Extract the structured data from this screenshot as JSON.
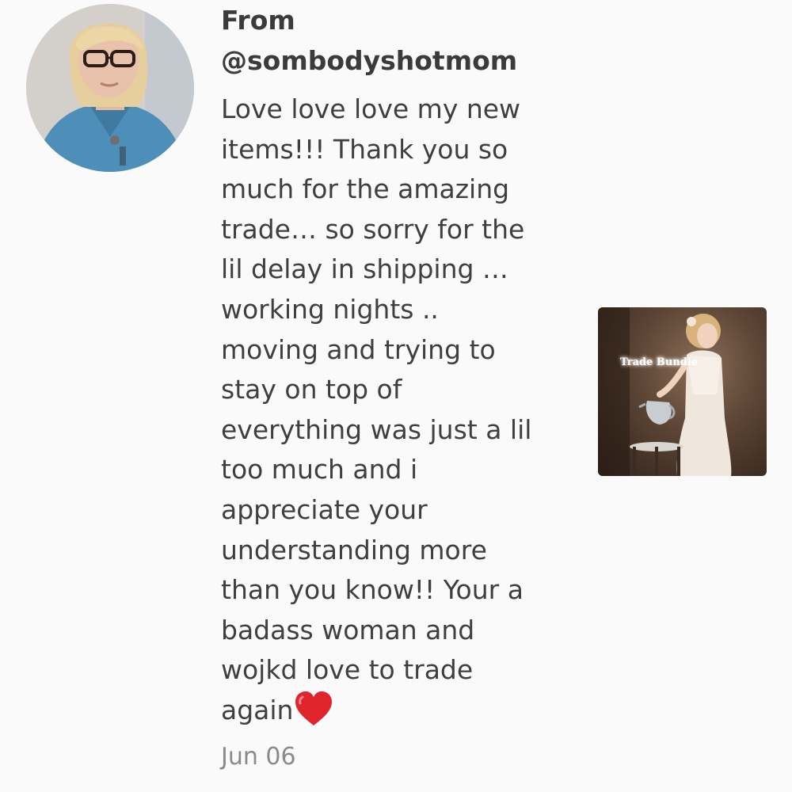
{
  "review": {
    "from_label": "From",
    "username": "@sombodyshotmom",
    "message": "Love love love my new\nitems!!! Thank you so\nmuch for the amazing\ntrade… so sorry for the\nlil delay in shipping …\nworking nights ..\nmoving and trying to\nstay on top of\neverything was just a lil\ntoo much and i\nappreciate your\nunderstanding more\nthan you know!! Your a\nbadass woman and\nwojkd love to trade\nagain",
    "emoji": "red-heart",
    "date": "Jun 06"
  },
  "listing": {
    "title": "Trade Bundle"
  },
  "colors": {
    "background": "#fbfafb",
    "text": "#3f3f3f",
    "date": "#8a8a8a",
    "heart": "#e0242c"
  }
}
